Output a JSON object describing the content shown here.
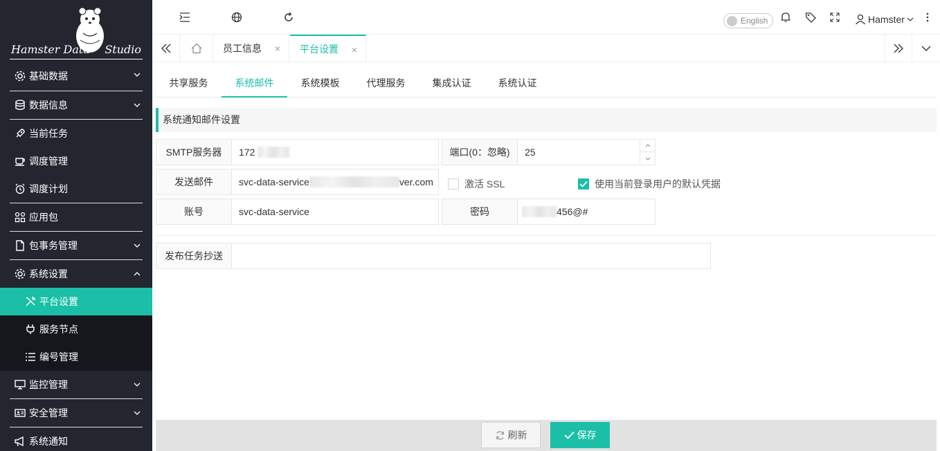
{
  "sidebar": {
    "logo_text_left": "Hamster Data",
    "logo_text_right": "Studio",
    "items": [
      {
        "label": "基础数据",
        "icon": "gear-icon"
      },
      {
        "label": "数据信息",
        "icon": "database-icon"
      },
      {
        "label": "当前任务",
        "icon": "rocket-icon"
      },
      {
        "label": "调度管理",
        "icon": "cup-icon"
      },
      {
        "label": "调度计划",
        "icon": "alarm-clock-icon"
      },
      {
        "label": "应用包",
        "icon": "apps-icon"
      },
      {
        "label": "包事务管理",
        "icon": "file-icon"
      },
      {
        "label": "系统设置",
        "icon": "gear-icon"
      },
      {
        "label": "平台设置",
        "icon": "tools-icon"
      },
      {
        "label": "服务节点",
        "icon": "plug-icon"
      },
      {
        "label": "编号管理",
        "icon": "list-icon"
      },
      {
        "label": "监控管理",
        "icon": "monitor-icon"
      },
      {
        "label": "安全管理",
        "icon": "id-card-icon"
      },
      {
        "label": "系统通知",
        "icon": "megaphone-icon"
      }
    ]
  },
  "topbar": {
    "language": "English",
    "user": "Hamster"
  },
  "page_tabs": [
    {
      "label": "员工信息"
    },
    {
      "label": "平台设置"
    }
  ],
  "sub_tabs": [
    "共享服务",
    "系统邮件",
    "系统模板",
    "代理服务",
    "集成认证",
    "系统认证"
  ],
  "section_title": "系统通知邮件设置",
  "form": {
    "smtp_label": "SMTP服务器",
    "smtp_value": "172",
    "port_label": "端口(0：忽略)",
    "port_value": "25",
    "sender_label": "发送邮件",
    "sender_value_start": "svc-data-service",
    "sender_value_end": "ver.com",
    "ssl_label": "激活 SSL",
    "ssl_checked": false,
    "default_cred_label": "使用当前登录用户的默认凭据",
    "default_cred_checked": true,
    "account_label": "账号",
    "account_value": "svc-data-service",
    "password_label": "密码",
    "password_value": "456@#",
    "cc_label": "发布任务抄送",
    "cc_value": ""
  },
  "buttons": {
    "refresh": "刷新",
    "save": "保存"
  },
  "colors": {
    "accent": "#1bbfa7",
    "sidebar_bg": "#23262e"
  }
}
